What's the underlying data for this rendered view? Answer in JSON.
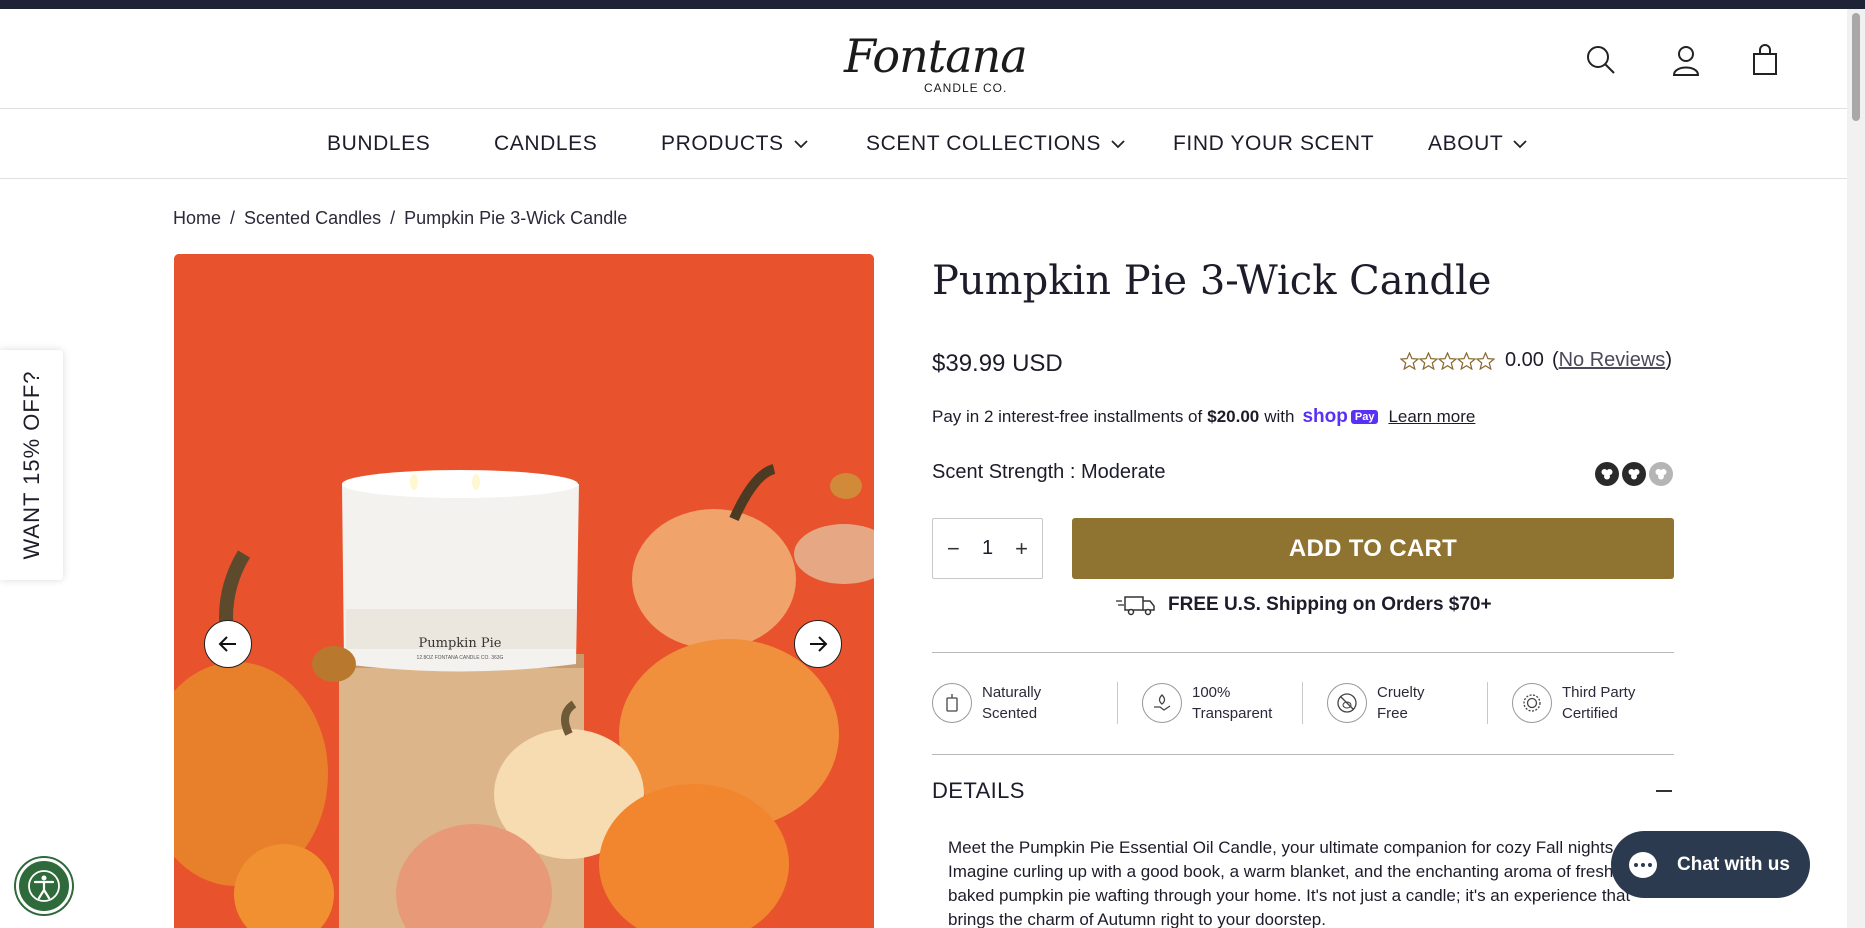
{
  "header": {
    "logo_script": "Fontana",
    "logo_sub": "CANDLE CO.",
    "icons": [
      "search-icon",
      "account-icon",
      "cart-icon"
    ]
  },
  "nav": {
    "items": [
      {
        "label": "BUNDLES",
        "dropdown": false
      },
      {
        "label": "CANDLES",
        "dropdown": false
      },
      {
        "label": "PRODUCTS",
        "dropdown": true
      },
      {
        "label": "SCENT COLLECTIONS",
        "dropdown": true
      },
      {
        "label": "FIND YOUR SCENT",
        "dropdown": false
      },
      {
        "label": "ABOUT",
        "dropdown": true
      }
    ]
  },
  "breadcrumb": {
    "home": "Home",
    "category": "Scented Candles",
    "current": "Pumpkin Pie 3-Wick Candle",
    "separator": "/"
  },
  "side_tab": {
    "label": "WANT 15% OFF?"
  },
  "product": {
    "title": "Pumpkin Pie 3-Wick Candle",
    "price": "$39.99 USD",
    "rating_value": "0.00",
    "rating_stars": 0,
    "reviews_open": "(",
    "reviews_link": "No Reviews",
    "reviews_close": ")",
    "installments_prefix": "Pay in 2 interest-free installments of",
    "installments_amount": "$20.00",
    "installments_with": "with",
    "shoppay_brand": "shop",
    "shoppay_pay": "Pay",
    "learn_more": "Learn more",
    "strength_label": "Scent Strength : Moderate",
    "strength_level": 2,
    "strength_max": 3,
    "quantity": "1",
    "qty_minus": "−",
    "qty_plus": "+",
    "add_to_cart": "ADD TO CART",
    "shipping": "FREE U.S. Shipping on Orders $70+",
    "features": [
      {
        "line1": "Naturally",
        "line2": "Scented",
        "icon": "jar-icon"
      },
      {
        "line1": "100%",
        "line2": "Transparent",
        "icon": "hand-leaf-icon"
      },
      {
        "line1": "Cruelty",
        "line2": "Free",
        "icon": "bunny-icon"
      },
      {
        "line1": "Third Party",
        "line2": "Certified",
        "icon": "certified-seal-icon"
      }
    ],
    "details_heading": "DETAILS",
    "details_text": "Meet the Pumpkin Pie Essential Oil Candle, your ultimate companion for cozy Fall nights. Imagine curling up with a good book, a warm blanket, and the enchanting aroma of freshly baked pumpkin pie wafting through your home. It's not just a candle; it's an experience that brings the charm of Autumn right to your doorstep."
  },
  "gallery": {
    "jar_label": "Pumpkin Pie",
    "jar_sub": "12.8OZ   FONTANA CANDLE CO.   363G"
  },
  "chat": {
    "label": "Chat with us"
  },
  "colors": {
    "accent": "#8f7330",
    "image_bg": "#e8502b",
    "chat_bg": "#2b3a4e",
    "shoppay": "#5a31f4",
    "a11y": "#2f6a3a"
  }
}
